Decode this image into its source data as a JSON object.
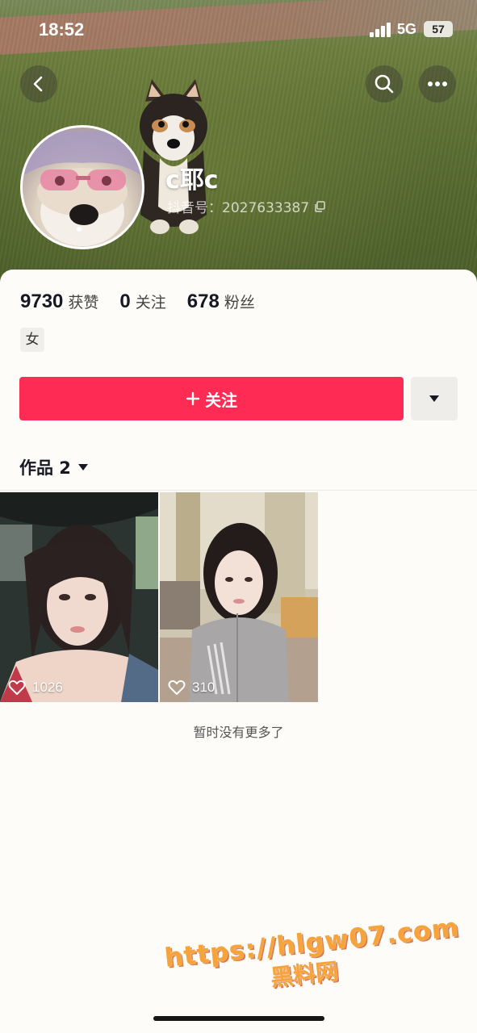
{
  "status_bar": {
    "time": "18:52",
    "network": "5G",
    "battery": "57"
  },
  "header": {
    "back_icon": "chevron-left-icon",
    "search_icon": "search-icon",
    "more_icon": "ellipsis-icon"
  },
  "profile": {
    "nickname": "c耶c",
    "douyin_id": "抖音号：2027633387",
    "gender": "女"
  },
  "stats": [
    {
      "value": "9730",
      "label": "获赞"
    },
    {
      "value": "0",
      "label": "关注"
    },
    {
      "value": "678",
      "label": "粉丝"
    }
  ],
  "actions": {
    "follow_label": "关注"
  },
  "works": {
    "tab_label": "作品 2",
    "items": [
      {
        "likes": "1026"
      },
      {
        "likes": "310"
      }
    ],
    "end_text": "暂时没有更多了"
  },
  "watermark": {
    "url": "https://hlgw07.com",
    "name": "黑料网"
  },
  "colors": {
    "accent": "#fe2c55"
  }
}
